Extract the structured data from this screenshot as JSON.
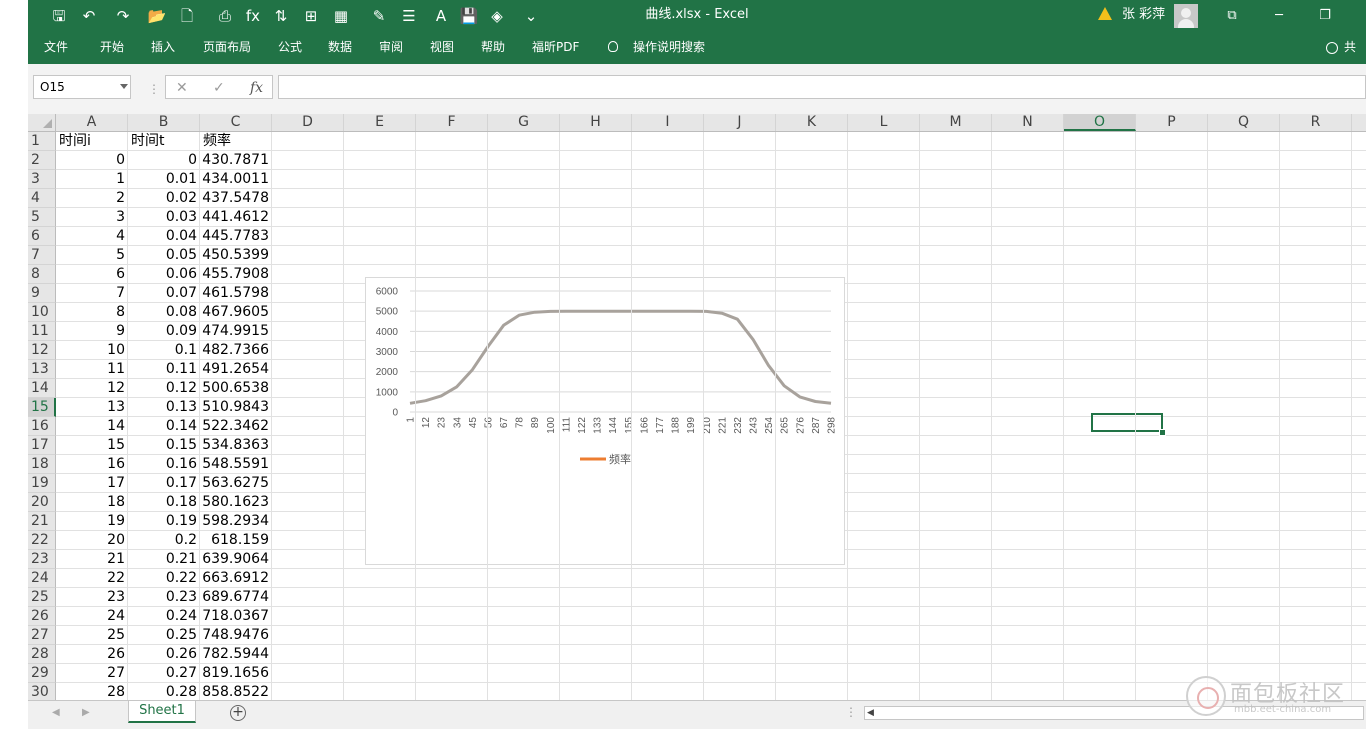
{
  "titlebar": {
    "doc_title": "曲线.xlsx  -  Excel",
    "user_name": "张 彩萍",
    "quick_access": [
      {
        "name": "save-icon",
        "glyph": "🖫"
      },
      {
        "name": "undo-icon",
        "glyph": "↶"
      },
      {
        "name": "redo-icon",
        "glyph": "↷"
      },
      {
        "name": "open-icon",
        "glyph": "📂"
      },
      {
        "name": "new-icon",
        "glyph": "🗋"
      },
      {
        "name": "print-preview-icon",
        "glyph": "⎙"
      },
      {
        "name": "insert-function-icon",
        "glyph": "fx"
      },
      {
        "name": "sort-icon",
        "glyph": "⇅"
      },
      {
        "name": "borders-icon",
        "glyph": "⊞"
      },
      {
        "name": "table-icon",
        "glyph": "▦"
      },
      {
        "name": "format-painter-icon",
        "glyph": "✎"
      },
      {
        "name": "form-icon",
        "glyph": "☰"
      },
      {
        "name": "font-size-icon",
        "glyph": "A"
      },
      {
        "name": "save-as-icon",
        "glyph": "💾"
      },
      {
        "name": "fill-color-icon",
        "glyph": "◈"
      },
      {
        "name": "customize-icon",
        "glyph": "⌄"
      }
    ],
    "window": {
      "restore": "⧉",
      "minimize": "─",
      "maximize": "❐"
    }
  },
  "ribbon": {
    "tabs": [
      "文件",
      "开始",
      "插入",
      "页面布局",
      "公式",
      "数据",
      "审阅",
      "视图",
      "帮助",
      "福昕PDF",
      "操作说明搜索"
    ],
    "share": "共享"
  },
  "formula_bar": {
    "name_box": "O15",
    "cancel": "✕",
    "enter": "✓",
    "fx": "fx",
    "separator": "⋮",
    "value": ""
  },
  "columns": [
    "A",
    "B",
    "C",
    "D",
    "E",
    "F",
    "G",
    "H",
    "I",
    "J",
    "K",
    "L",
    "M",
    "N",
    "O",
    "P",
    "Q",
    "R"
  ],
  "selected_column": "O",
  "selected_row": 15,
  "rows": [
    1,
    2,
    3,
    4,
    5,
    6,
    7,
    8,
    9,
    10,
    11,
    12,
    13,
    14,
    15,
    16,
    17,
    18,
    19,
    20,
    21,
    22,
    23,
    24,
    25,
    26,
    27,
    28,
    29,
    30
  ],
  "header_row": [
    "时间i",
    "时间t",
    "频率"
  ],
  "data": [
    [
      "0",
      "0",
      "430.7871"
    ],
    [
      "1",
      "0.01",
      "434.0011"
    ],
    [
      "2",
      "0.02",
      "437.5478"
    ],
    [
      "3",
      "0.03",
      "441.4612"
    ],
    [
      "4",
      "0.04",
      "445.7783"
    ],
    [
      "5",
      "0.05",
      "450.5399"
    ],
    [
      "6",
      "0.06",
      "455.7908"
    ],
    [
      "7",
      "0.07",
      "461.5798"
    ],
    [
      "8",
      "0.08",
      "467.9605"
    ],
    [
      "9",
      "0.09",
      "474.9915"
    ],
    [
      "10",
      "0.1",
      "482.7366"
    ],
    [
      "11",
      "0.11",
      "491.2654"
    ],
    [
      "12",
      "0.12",
      "500.6538"
    ],
    [
      "13",
      "0.13",
      "510.9843"
    ],
    [
      "14",
      "0.14",
      "522.3462"
    ],
    [
      "15",
      "0.15",
      "534.8363"
    ],
    [
      "16",
      "0.16",
      "548.5591"
    ],
    [
      "17",
      "0.17",
      "563.6275"
    ],
    [
      "18",
      "0.18",
      "580.1623"
    ],
    [
      "19",
      "0.19",
      "598.2934"
    ],
    [
      "20",
      "0.2",
      "618.159"
    ],
    [
      "21",
      "0.21",
      "639.9064"
    ],
    [
      "22",
      "0.22",
      "663.6912"
    ],
    [
      "23",
      "0.23",
      "689.6774"
    ],
    [
      "24",
      "0.24",
      "718.0367"
    ],
    [
      "25",
      "0.25",
      "748.9476"
    ],
    [
      "26",
      "0.26",
      "782.5944"
    ],
    [
      "27",
      "0.27",
      "819.1656"
    ],
    [
      "28",
      "0.28",
      "858.8522"
    ]
  ],
  "chart_data": {
    "type": "line",
    "title": "",
    "xlabel": "",
    "ylabel": "",
    "ylim": [
      0,
      6000
    ],
    "yticks": [
      0,
      1000,
      2000,
      3000,
      4000,
      5000,
      6000
    ],
    "xticks": [
      "1",
      "12",
      "23",
      "34",
      "45",
      "56",
      "67",
      "78",
      "89",
      "100",
      "111",
      "122",
      "133",
      "144",
      "155",
      "166",
      "177",
      "188",
      "199",
      "210",
      "221",
      "232",
      "243",
      "254",
      "265",
      "276",
      "287",
      "298"
    ],
    "grid": true,
    "legend_position": "bottom",
    "series": [
      {
        "name": "频率",
        "color": "#a8a29c",
        "legend_color": "#ed7d31",
        "x": [
          1,
          12,
          23,
          34,
          45,
          56,
          67,
          78,
          89,
          100,
          111,
          122,
          133,
          144,
          155,
          166,
          177,
          188,
          199,
          210,
          221,
          232,
          243,
          254,
          265,
          276,
          287,
          298
        ],
        "values": [
          430,
          560,
          800,
          1250,
          2100,
          3250,
          4300,
          4800,
          4950,
          4990,
          5000,
          5000,
          5000,
          5000,
          5000,
          5000,
          5000,
          5000,
          5000,
          4990,
          4900,
          4600,
          3600,
          2300,
          1300,
          750,
          520,
          430
        ]
      }
    ]
  },
  "sheet_tabs": {
    "active": "Sheet1",
    "add": "+",
    "nav_prev": "◀",
    "nav_next": "▶",
    "scroll_left": "◀",
    "separator": "⋮"
  },
  "watermark": {
    "text": "面包板社区",
    "sub": "mbb.eet-china.com"
  },
  "colors": {
    "excel_green": "#217346",
    "warning": "#f2c01b"
  }
}
